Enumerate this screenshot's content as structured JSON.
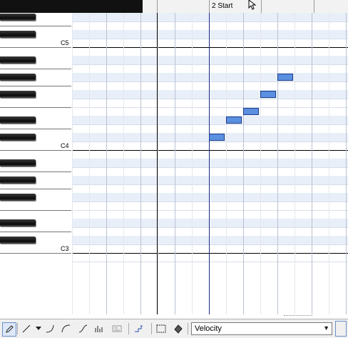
{
  "ruler": {
    "marker_label": "2 Start"
  },
  "keyboard": {
    "octave_labels": [
      "C5",
      "C4",
      "C3"
    ]
  },
  "toolbar": {
    "tools": [
      "draw-tool-icon",
      "line-tool-icon",
      "dropdown-arrow-icon",
      "curve-a-icon",
      "curve-b-icon",
      "curve-c-icon",
      "velocity-bars-icon",
      "controller-icon",
      "quantize-icon",
      "select-rect-icon",
      "erase-tool-icon"
    ],
    "velocity_label": "Velocity"
  },
  "notes": [
    {
      "pitch": "C#4",
      "beat": 9
    },
    {
      "pitch": "D#4",
      "beat": 10
    },
    {
      "pitch": "E4",
      "beat": 11
    },
    {
      "pitch": "F#4",
      "beat": 12
    },
    {
      "pitch": "G#4",
      "beat": 13
    }
  ],
  "colors": {
    "note_fill": "#5b8fe0",
    "note_border": "#1a3c8a",
    "black_row": "#e9eff9",
    "beat_line": "#1a2a80"
  }
}
